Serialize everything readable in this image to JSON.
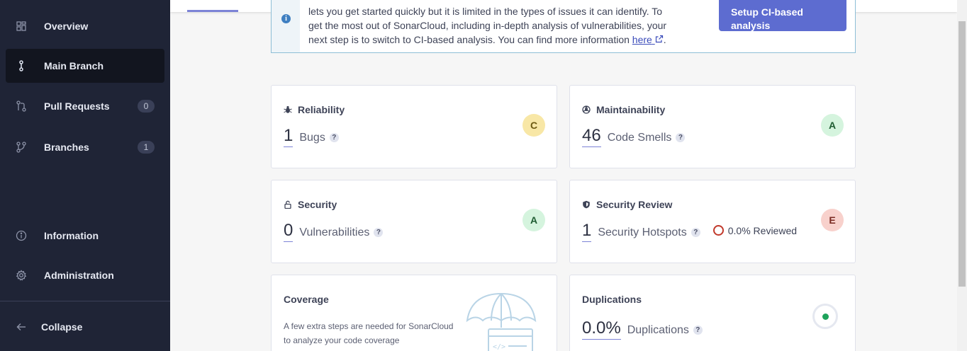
{
  "sidebar": {
    "items": [
      {
        "label": "Overview",
        "icon": "overview-grid-icon"
      },
      {
        "label": "Main Branch",
        "icon": "branch-icon"
      },
      {
        "label": "Pull Requests",
        "icon": "pull-request-icon",
        "badge": "0"
      },
      {
        "label": "Branches",
        "icon": "branches-icon",
        "badge": "1"
      },
      {
        "label": "Information",
        "icon": "info-icon"
      },
      {
        "label": "Administration",
        "icon": "gear-icon"
      }
    ],
    "collapse_label": "Collapse"
  },
  "banner": {
    "text_line1": "lets you get started quickly but it is limited in the types of issues it can identify. To",
    "text_line2": "get the most out of SonarCloud, including in-depth analysis of vulnerabilities, your",
    "text_line3": "next step is to switch to CI-based analysis. You can find more information ",
    "link_text": "here",
    "text_end": ".",
    "button_line1": "Setup CI-based",
    "button_line2": "analysis"
  },
  "cards": {
    "reliability": {
      "title": "Reliability",
      "value": "1",
      "label": "Bugs",
      "rating": "C"
    },
    "maintainability": {
      "title": "Maintainability",
      "value": "46",
      "label": "Code Smells",
      "rating": "A"
    },
    "security": {
      "title": "Security",
      "value": "0",
      "label": "Vulnerabilities",
      "rating": "A"
    },
    "security_review": {
      "title": "Security Review",
      "value": "1",
      "label": "Security Hotspots",
      "reviewed": "0.0% Reviewed",
      "rating": "E"
    },
    "coverage": {
      "title": "Coverage",
      "text_line1": "A few extra steps are needed for SonarCloud",
      "text_line2": "to analyze your code coverage"
    },
    "duplications": {
      "title": "Duplications",
      "value": "0.0%",
      "label": "Duplications"
    }
  },
  "help_glyph": "?",
  "info_glyph": "i",
  "colors": {
    "sidebar_bg": "#1f2436",
    "accent": "#5d6cd0",
    "rating_c": "#f8e7a6",
    "rating_a": "#d5f4de",
    "rating_e": "#f8d1cc",
    "hotspot_ring": "#c1392b",
    "duplication_dot": "#1ea35b"
  }
}
